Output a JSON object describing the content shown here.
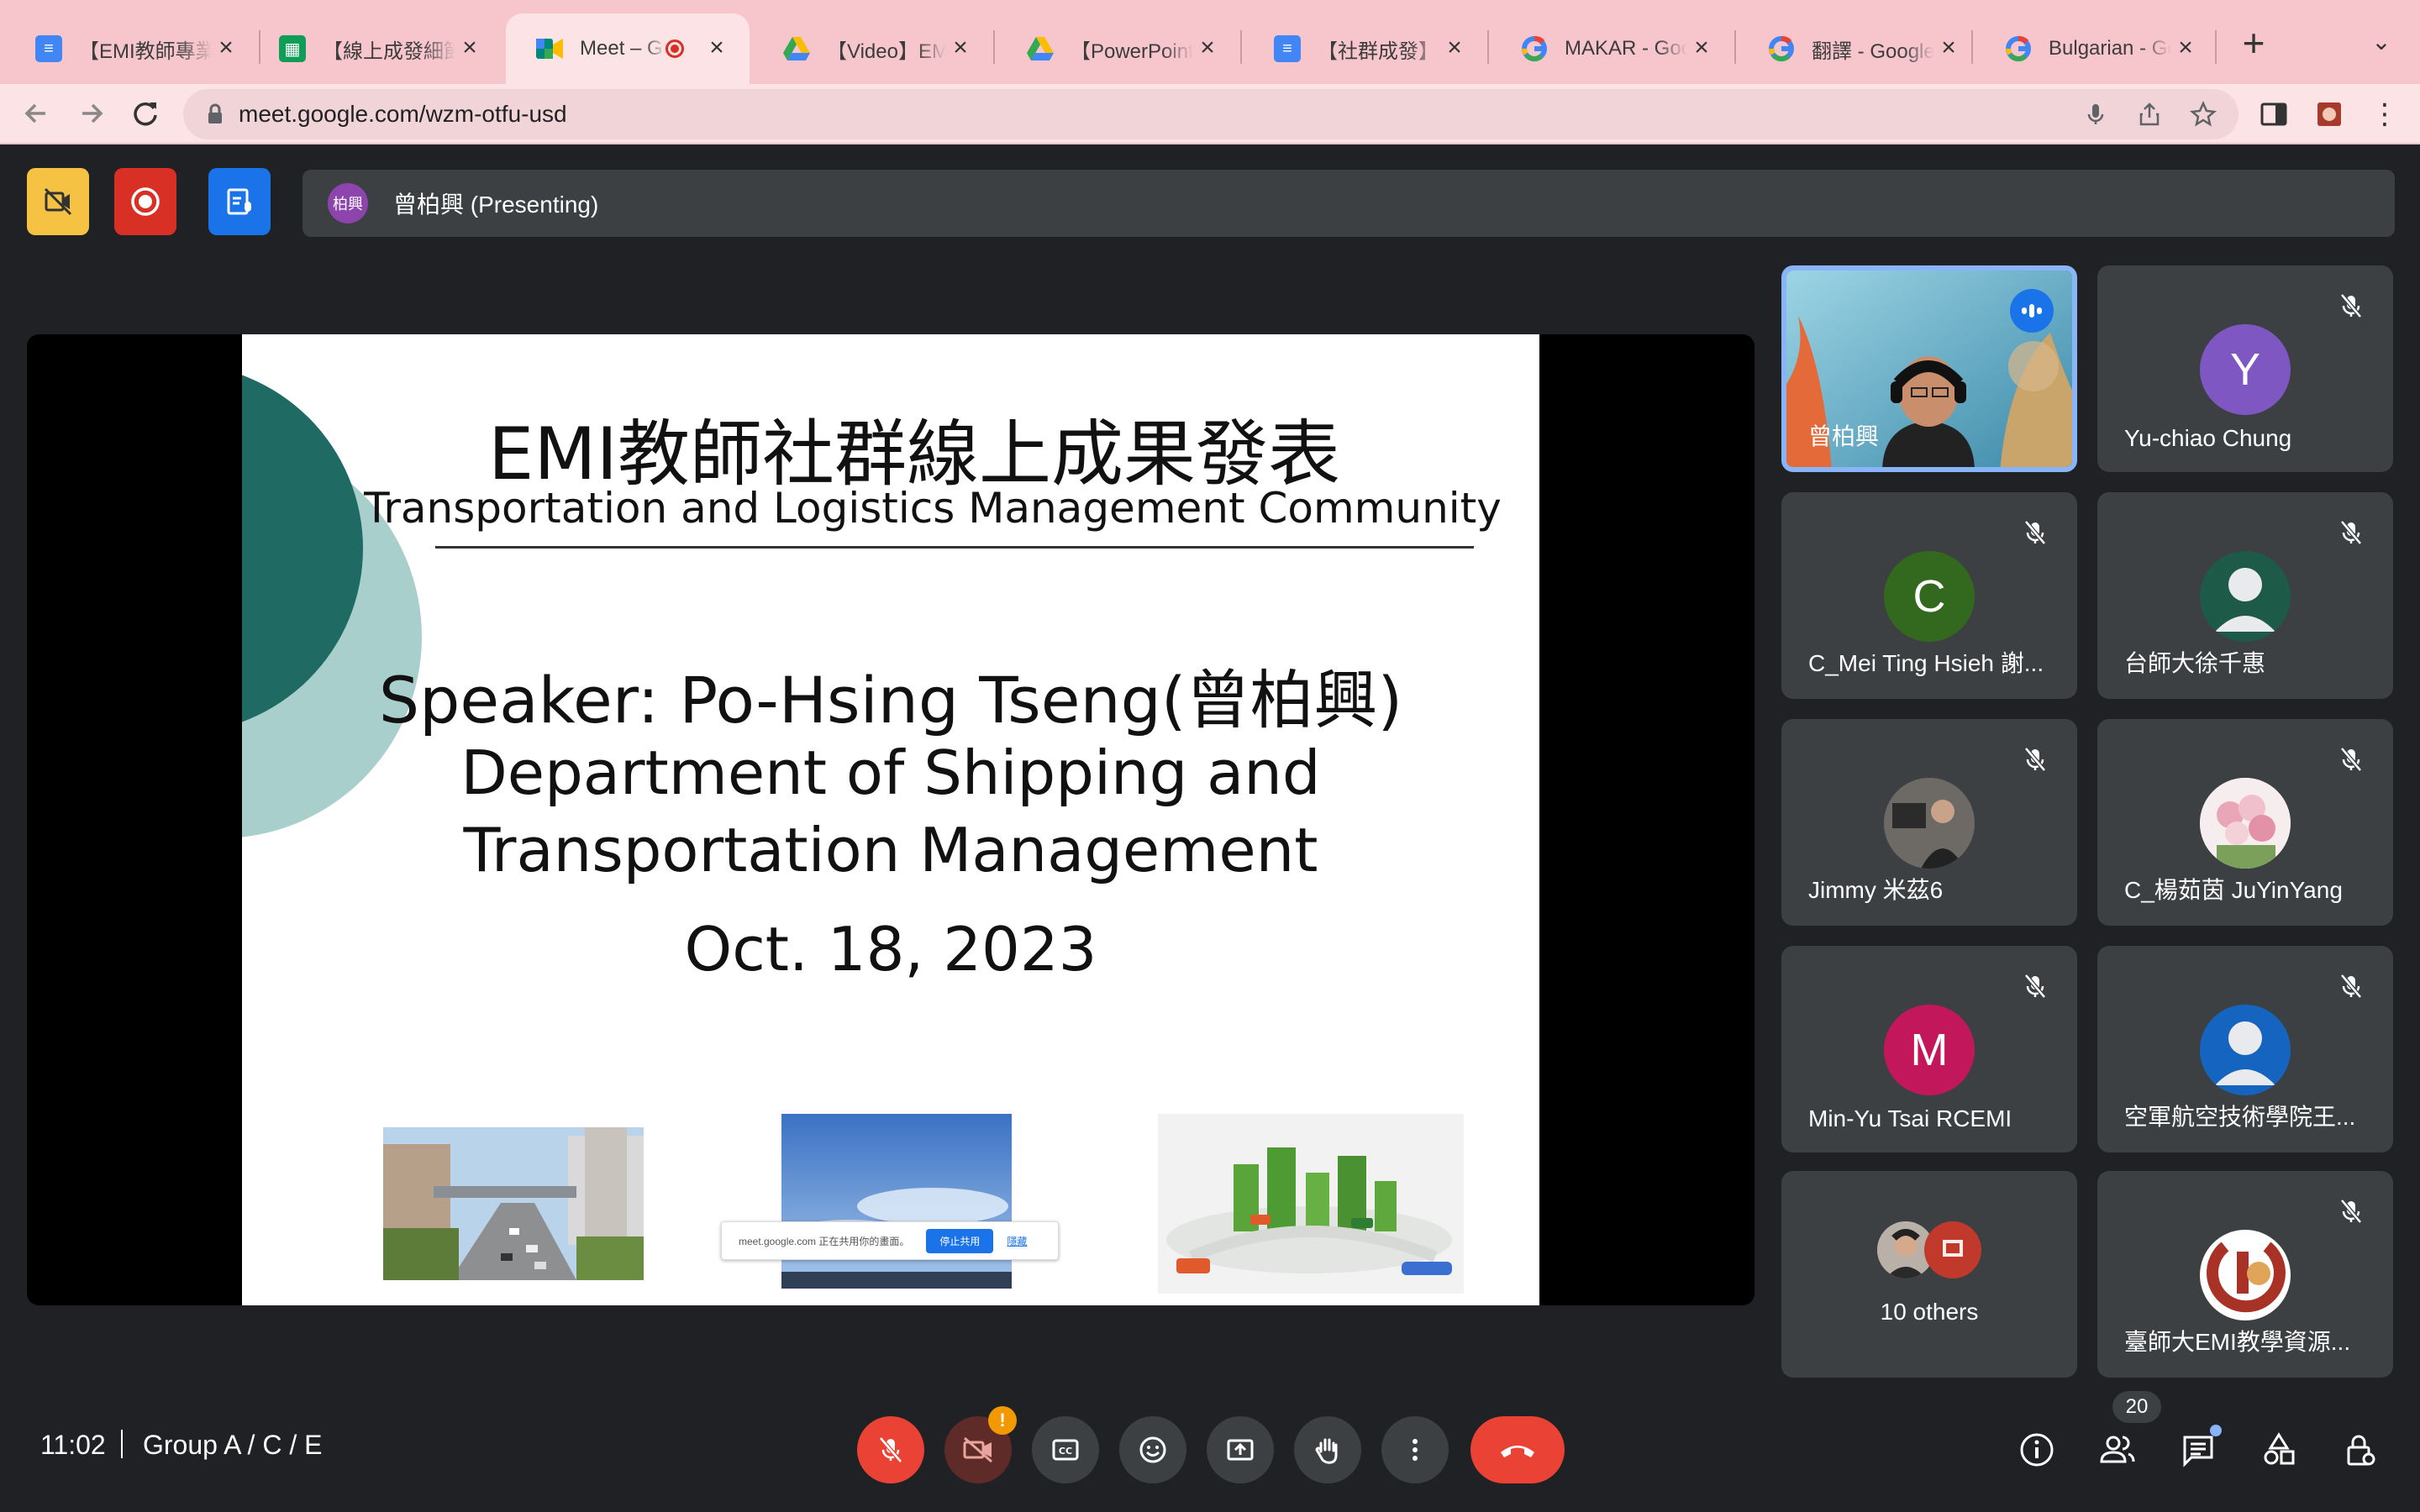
{
  "browser": {
    "tabs": [
      {
        "title": "【EMI教師專業",
        "icon": "google-docs-icon",
        "color": "#4285f4"
      },
      {
        "title": "【線上成發細節",
        "icon": "google-sheets-icon",
        "color": "#0f9d58"
      },
      {
        "title": "Meet – Gr",
        "icon": "google-meet-icon",
        "color": "#00897b",
        "active": true
      },
      {
        "title": "【Video】EMI",
        "icon": "google-drive-icon",
        "color": "#fbbc04"
      },
      {
        "title": "【PowerPoint",
        "icon": "google-drive-icon",
        "color": "#fbbc04"
      },
      {
        "title": "【社群成發】數",
        "icon": "google-docs-icon",
        "color": "#4285f4"
      },
      {
        "title": "MAKAR - Goo",
        "icon": "google-icon",
        "color": "#4285f4"
      },
      {
        "title": "翻譯 - Google",
        "icon": "google-icon",
        "color": "#4285f4"
      },
      {
        "title": "Bulgarian - Go",
        "icon": "google-icon",
        "color": "#4285f4"
      }
    ],
    "url": "meet.google.com/wzm-otfu-usd"
  },
  "meet": {
    "presenter_initials": "柏興",
    "presenting_label": "曾柏興 (Presenting)",
    "slide": {
      "title": "EMI教師社群線上成果發表",
      "subtitle": "Transportation and Logistics Management Community",
      "speaker": "Speaker: Po-Hsing Tseng(曾柏興)",
      "department_line1": "Department of Shipping and",
      "department_line2": "Transportation Management",
      "date": "Oct. 18, 2023"
    },
    "share_notice": {
      "text": "meet.google.com 正在共用你的畫面。",
      "stop_label": "停止共用",
      "hide_label": "隱藏"
    },
    "participants": [
      {
        "name": "曾柏興",
        "speaking": true
      },
      {
        "name": "Yu-chiao Chung",
        "initial": "Y",
        "color": "#7e57c2"
      },
      {
        "name": "C_Mei Ting Hsieh 謝...",
        "initial": "C",
        "color": "#33691e"
      },
      {
        "name": "台師大徐千惠",
        "color": "#1e5a48"
      },
      {
        "name": "Jimmy 米茲6"
      },
      {
        "name": "C_楊茹茵 JuYinYang"
      },
      {
        "name": "Min-Yu Tsai RCEMI",
        "initial": "M",
        "color": "#c2185b"
      },
      {
        "name": "空軍航空技術學院王...",
        "color": "#1565c0"
      },
      {
        "name": "10 others"
      },
      {
        "name": "臺師大EMI教學資源..."
      }
    ],
    "clock": "11:02",
    "meeting_name": "Group A / C / E",
    "people_count": "20"
  }
}
